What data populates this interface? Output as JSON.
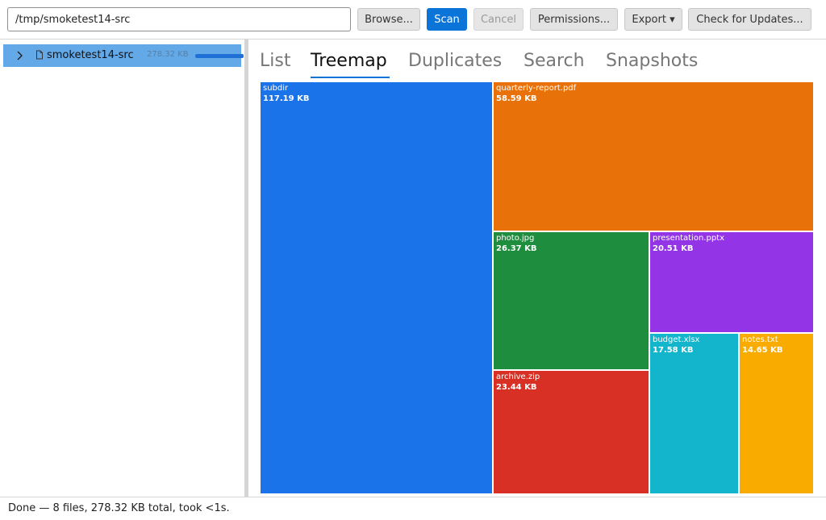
{
  "toolbar": {
    "path_value": "/tmp/smoketest14-src",
    "browse_label": "Browse...",
    "scan_label": "Scan",
    "cancel_label": "Cancel",
    "permissions_label": "Permissions...",
    "export_label": "Export ▾",
    "updates_label": "Check for Updates..."
  },
  "tree": {
    "root": {
      "name": "smoketest14-src",
      "size": "278.32 KB",
      "fraction": 1.0,
      "expand_icon": "chevron-right-icon",
      "type_icon": "document-icon"
    }
  },
  "tabs": [
    {
      "label": "List",
      "active": false
    },
    {
      "label": "Treemap",
      "active": true
    },
    {
      "label": "Duplicates",
      "active": false
    },
    {
      "label": "Search",
      "active": false
    },
    {
      "label": "Snapshots",
      "active": false
    }
  ],
  "treemap": {
    "items": [
      {
        "name": "subdir",
        "size": "117.19 KB",
        "color": "#1a73e8"
      },
      {
        "name": "quarterly-report.pdf",
        "size": "58.59 KB",
        "color": "#e8710a"
      },
      {
        "name": "photo.jpg",
        "size": "26.37 KB",
        "color": "#1e8e3e"
      },
      {
        "name": "archive.zip",
        "size": "23.44 KB",
        "color": "#d93025"
      },
      {
        "name": "presentation.pptx",
        "size": "20.51 KB",
        "color": "#9334e6"
      },
      {
        "name": "budget.xlsx",
        "size": "17.58 KB",
        "color": "#12b5cb"
      },
      {
        "name": "notes.txt",
        "size": "14.65 KB",
        "color": "#f9ab00"
      }
    ]
  },
  "status": {
    "text": "Done — 8 files, 278.32 KB total, took <1s."
  },
  "colors": {
    "accent": "#0b74d8",
    "selection": "#63a9e8"
  }
}
